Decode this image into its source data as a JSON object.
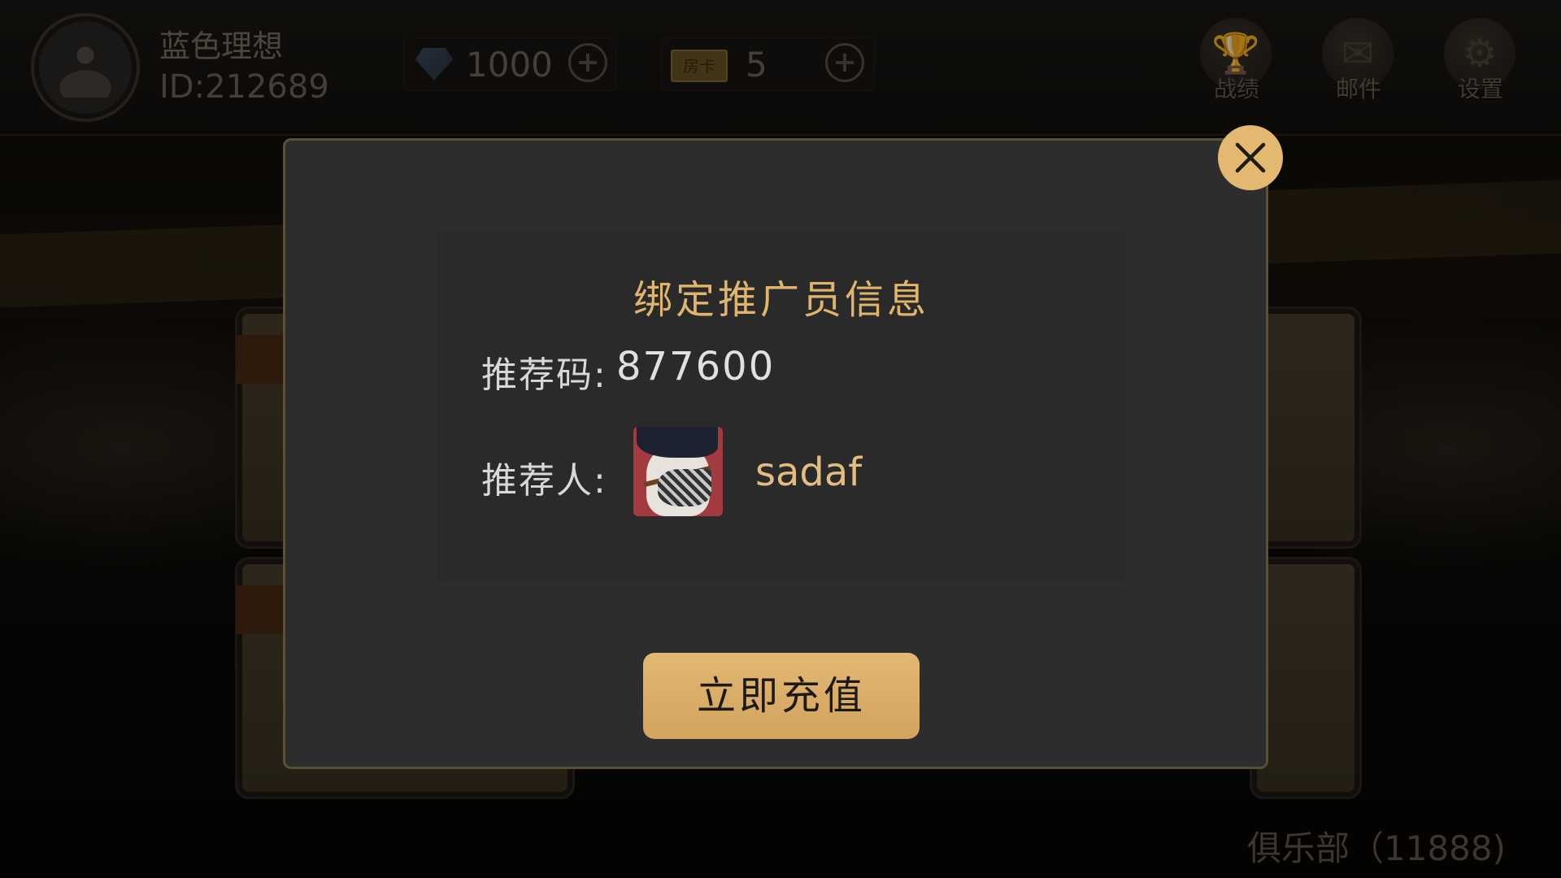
{
  "header": {
    "username": "蓝色理想",
    "user_id": "ID:212689",
    "diamonds": "1000",
    "room_card_badge": "房卡",
    "room_cards": "5",
    "buttons": {
      "record": "战绩",
      "mail": "邮件",
      "settings": "设置"
    }
  },
  "background": {
    "club_label": "俱乐部（11888)"
  },
  "modal": {
    "title": "绑定推广员信息",
    "code_label": "推荐码:",
    "code_value": "877600",
    "referrer_label": "推荐人:",
    "referrer_name": "sadaf",
    "recharge_button": "立即充值"
  },
  "colors": {
    "accent": "#e2b873",
    "modal_bg": "#2d2d2d",
    "title": "#e0b46c"
  },
  "icons": {
    "diamond": "diamond-icon",
    "room_card": "room-card-icon",
    "plus": "plus-icon",
    "record": "trophy-icon",
    "mail": "mail-icon",
    "settings": "gear-icon",
    "close": "close-icon"
  }
}
